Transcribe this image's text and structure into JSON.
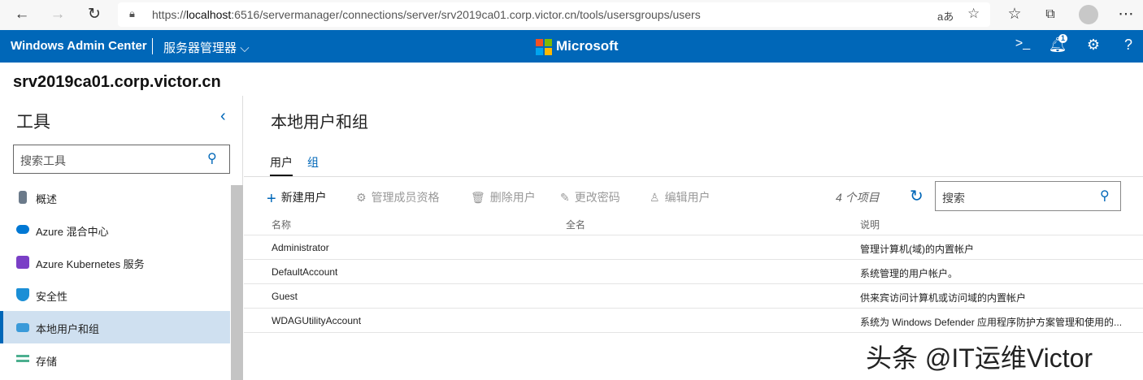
{
  "browser": {
    "url_prefix": "https://",
    "url_host": "localhost",
    "url_rest": ":6516/servermanager/connections/server/srv2019ca01.corp.victor.cn/tools/usersgroups/users",
    "read_aloud": "aあ"
  },
  "header": {
    "app_title": "Windows Admin Center",
    "context": "服务器管理器",
    "brand": "Microsoft",
    "notification_count": "1",
    "help": "?"
  },
  "server_name": "srv2019ca01.corp.victor.cn",
  "sidebar": {
    "title": "工具",
    "search_placeholder": "搜索工具",
    "items": [
      {
        "label": "概述",
        "icon": "server-icon",
        "color": "#6b7a8a"
      },
      {
        "label": "Azure 混合中心",
        "icon": "cloud-icon",
        "color": "#0078d4"
      },
      {
        "label": "Azure Kubernetes 服务",
        "icon": "kubernetes-icon",
        "color": "#7a3fc6"
      },
      {
        "label": "安全性",
        "icon": "shield-icon",
        "color": "#1b8fd6"
      },
      {
        "label": "本地用户和组",
        "icon": "users-icon",
        "color": "#3a9ad9",
        "selected": true
      },
      {
        "label": "存储",
        "icon": "storage-icon",
        "color": "#4caf8f"
      }
    ]
  },
  "main": {
    "title": "本地用户和组",
    "tabs": [
      {
        "label": "用户",
        "active": true
      },
      {
        "label": "组"
      }
    ],
    "toolbar": {
      "new_user": "新建用户",
      "manage_membership": "管理成员资格",
      "delete_user": "删除用户",
      "change_password": "更改密码",
      "edit_user": "编辑用户",
      "item_count": "4 个项目",
      "search_placeholder": "搜索"
    },
    "columns": [
      "名称",
      "全名",
      "说明"
    ],
    "rows": [
      {
        "name": "Administrator",
        "fullname": "",
        "description": "管理计算机(域)的内置帐户"
      },
      {
        "name": "DefaultAccount",
        "fullname": "",
        "description": "系统管理的用户帐户。"
      },
      {
        "name": "Guest",
        "fullname": "",
        "description": "供来宾访问计算机或访问域的内置帐户"
      },
      {
        "name": "WDAGUtilityAccount",
        "fullname": "",
        "description": "系统为 Windows Defender 应用程序防护方案管理和使用的..."
      }
    ]
  },
  "watermark": "头条 @IT运维Victor"
}
